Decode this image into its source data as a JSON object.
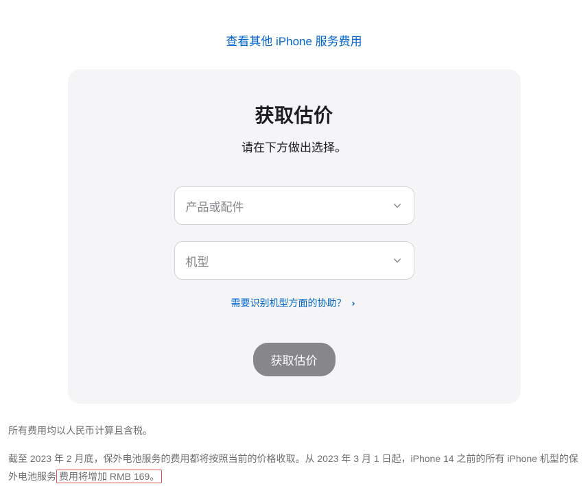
{
  "topLink": {
    "label": "查看其他 iPhone 服务费用"
  },
  "card": {
    "title": "获取估价",
    "subtitle": "请在下方做出选择。",
    "select1": {
      "placeholder": "产品或配件"
    },
    "select2": {
      "placeholder": "机型"
    },
    "helpLink": {
      "label": "需要识别机型方面的协助？"
    },
    "submitButton": {
      "label": "获取估价"
    }
  },
  "footer": {
    "line1": "所有费用均以人民币计算且含税。",
    "line2_part1": "截至 2023 年 2 月底，保外电池服务的费用都将按照当前的价格收取。从 2023 年 3 月 1 日起，iPhone 14 之前的所有 iPhone 机型的保外电池服务",
    "line2_highlight": "费用将增加 RMB 169。"
  }
}
